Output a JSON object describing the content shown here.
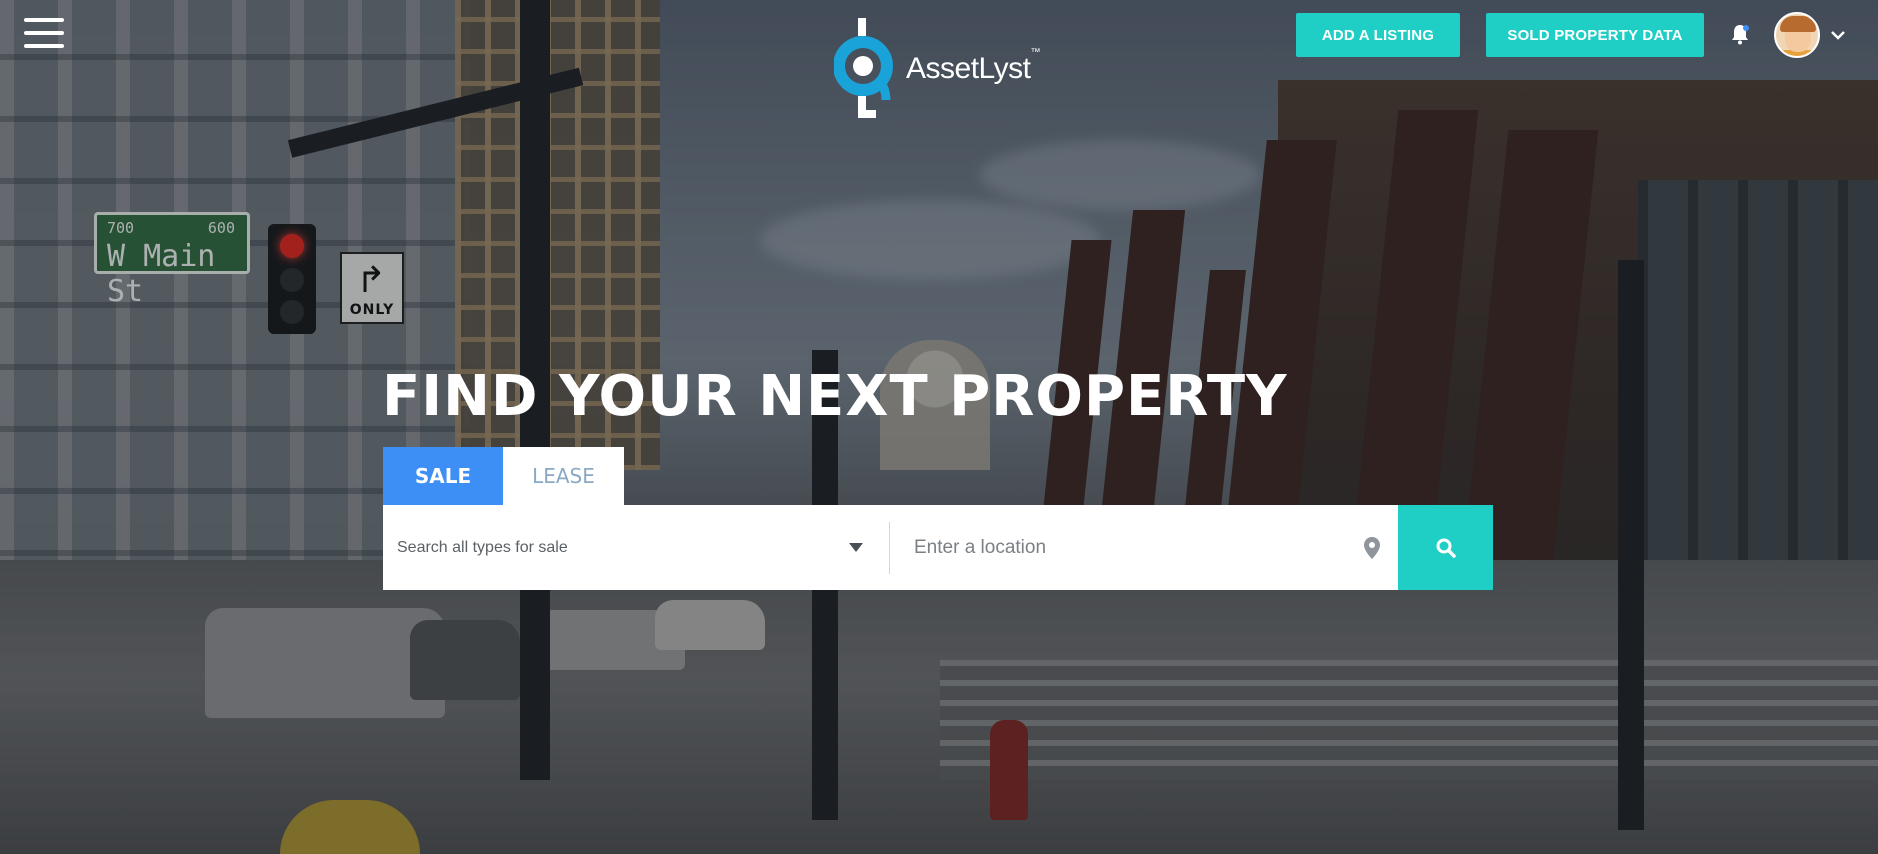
{
  "header": {
    "brand": "AssetLyst",
    "brand_tm": "™",
    "add_listing_label": "ADD A LISTING",
    "sold_data_label": "SOLD PROPERTY DATA"
  },
  "hero": {
    "title": "FIND YOUR NEXT PROPERTY",
    "tabs": [
      {
        "label": "SALE",
        "active": true
      },
      {
        "label": "LEASE",
        "active": false
      }
    ]
  },
  "search": {
    "type_placeholder": "Search all types for sale",
    "location_placeholder": "Enter a location"
  },
  "scene_signs": {
    "street_num_left": "700",
    "street_num_right": "600",
    "street_name": "W Main St",
    "turn_sign": "ONLY"
  },
  "colors": {
    "accent": "#1fcfc5",
    "tab_active": "#3d8ef5",
    "logo_blue": "#1aa3d9"
  },
  "icons": {
    "menu": "hamburger-icon",
    "notifications": "bell-icon",
    "avatar_menu": "chevron-down-icon",
    "type_dropdown": "caret-down-icon",
    "location": "map-pin-icon",
    "search": "search-icon"
  }
}
